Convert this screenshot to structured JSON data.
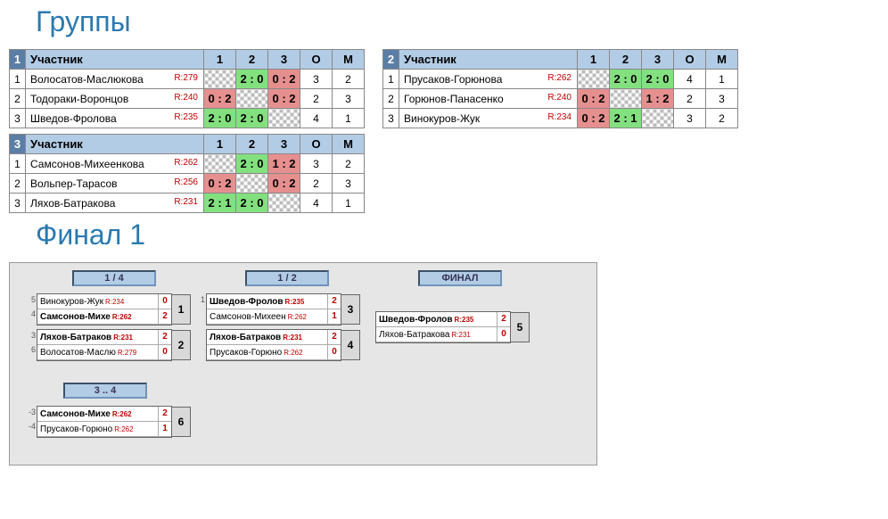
{
  "headings": {
    "groups": "Группы",
    "final": "Финал 1"
  },
  "headers": {
    "participant": "Участник",
    "c1": "1",
    "c2": "2",
    "c3": "3",
    "o": "О",
    "m": "М"
  },
  "groups": [
    {
      "num": "1",
      "rows": [
        {
          "idx": "1",
          "name": "Волосатов-Маслюкова",
          "rating": "R:279",
          "cells": [
            {
              "t": "self"
            },
            {
              "t": "win",
              "s": "2 : 0"
            },
            {
              "t": "loss",
              "s": "0 : 2"
            }
          ],
          "o": "3",
          "m": "2"
        },
        {
          "idx": "2",
          "name": "Тодораки-Воронцов",
          "rating": "R:240",
          "cells": [
            {
              "t": "loss",
              "s": "0 : 2"
            },
            {
              "t": "self"
            },
            {
              "t": "loss",
              "s": "0 : 2"
            }
          ],
          "o": "2",
          "m": "3"
        },
        {
          "idx": "3",
          "name": "Шведов-Фролова",
          "rating": "R:235",
          "cells": [
            {
              "t": "win",
              "s": "2 : 0"
            },
            {
              "t": "win",
              "s": "2 : 0"
            },
            {
              "t": "self"
            }
          ],
          "o": "4",
          "m": "1"
        }
      ]
    },
    {
      "num": "2",
      "rows": [
        {
          "idx": "1",
          "name": "Прусаков-Горюнова",
          "rating": "R:262",
          "cells": [
            {
              "t": "self"
            },
            {
              "t": "win",
              "s": "2 : 0"
            },
            {
              "t": "win",
              "s": "2 : 0"
            }
          ],
          "o": "4",
          "m": "1"
        },
        {
          "idx": "2",
          "name": "Горюнов-Панасенко",
          "rating": "R:240",
          "cells": [
            {
              "t": "loss",
              "s": "0 : 2"
            },
            {
              "t": "self"
            },
            {
              "t": "loss",
              "s": "1 : 2"
            }
          ],
          "o": "2",
          "m": "3"
        },
        {
          "idx": "3",
          "name": "Винокуров-Жук",
          "rating": "R:234",
          "cells": [
            {
              "t": "loss",
              "s": "0 : 2"
            },
            {
              "t": "win",
              "s": "2 : 1"
            },
            {
              "t": "self"
            }
          ],
          "o": "3",
          "m": "2"
        }
      ]
    },
    {
      "num": "3",
      "rows": [
        {
          "idx": "1",
          "name": "Самсонов-Михеенкова",
          "rating": "R:262",
          "cells": [
            {
              "t": "self"
            },
            {
              "t": "win",
              "s": "2 : 0"
            },
            {
              "t": "loss",
              "s": "1 : 2"
            }
          ],
          "o": "3",
          "m": "2"
        },
        {
          "idx": "2",
          "name": "Вольпер-Тарасов",
          "rating": "R:256",
          "cells": [
            {
              "t": "loss",
              "s": "0 : 2"
            },
            {
              "t": "self"
            },
            {
              "t": "loss",
              "s": "0 : 2"
            }
          ],
          "o": "2",
          "m": "3"
        },
        {
          "idx": "3",
          "name": "Ляхов-Батракова",
          "rating": "R:231",
          "cells": [
            {
              "t": "win",
              "s": "2 : 1"
            },
            {
              "t": "win",
              "s": "2 : 0"
            },
            {
              "t": "self"
            }
          ],
          "o": "4",
          "m": "1"
        }
      ]
    }
  ],
  "bracket": {
    "rounds": {
      "qf": "1 / 4",
      "sf": "1 / 2",
      "f": "ФИНАЛ",
      "third": "3 .. 4"
    },
    "matches": {
      "m1": {
        "num": "1",
        "seedA": "5",
        "seedB": "4",
        "a": {
          "name": "Винокуров-Жук",
          "rating": "R:234",
          "sc": "0"
        },
        "b": {
          "name": "Самсонов-Михе",
          "rating": "R:262",
          "sc": "2"
        },
        "winner": "b"
      },
      "m2": {
        "num": "2",
        "seedA": "3",
        "seedB": "6",
        "a": {
          "name": "Ляхов-Батраков",
          "rating": "R:231",
          "sc": "2"
        },
        "b": {
          "name": "Волосатов-Маслю",
          "rating": "R:279",
          "sc": "0"
        },
        "winner": "a"
      },
      "m3": {
        "num": "3",
        "seedA": "1",
        "seedB": "",
        "a": {
          "name": "Шведов-Фролов",
          "rating": "R:235",
          "sc": "2"
        },
        "b": {
          "name": "Самсонов-Михеен",
          "rating": "R:262",
          "sc": "1"
        },
        "winner": "a"
      },
      "m4": {
        "num": "4",
        "seedA": "",
        "seedB": "",
        "a": {
          "name": "Ляхов-Батраков",
          "rating": "R:231",
          "sc": "2"
        },
        "b": {
          "name": "Прусаков-Горюно",
          "rating": "R:262",
          "sc": "0"
        },
        "winner": "a"
      },
      "m5": {
        "num": "5",
        "seedA": "",
        "seedB": "",
        "a": {
          "name": "Шведов-Фролов",
          "rating": "R:235",
          "sc": "2"
        },
        "b": {
          "name": "Ляхов-Батракова",
          "rating": "R:231",
          "sc": "0"
        },
        "winner": "a"
      },
      "m6": {
        "num": "6",
        "seedA": "-3",
        "seedB": "-4",
        "a": {
          "name": "Самсонов-Михе",
          "rating": "R:262",
          "sc": "2"
        },
        "b": {
          "name": "Прусаков-Горюно",
          "rating": "R:262",
          "sc": "1"
        },
        "winner": "a"
      }
    }
  }
}
